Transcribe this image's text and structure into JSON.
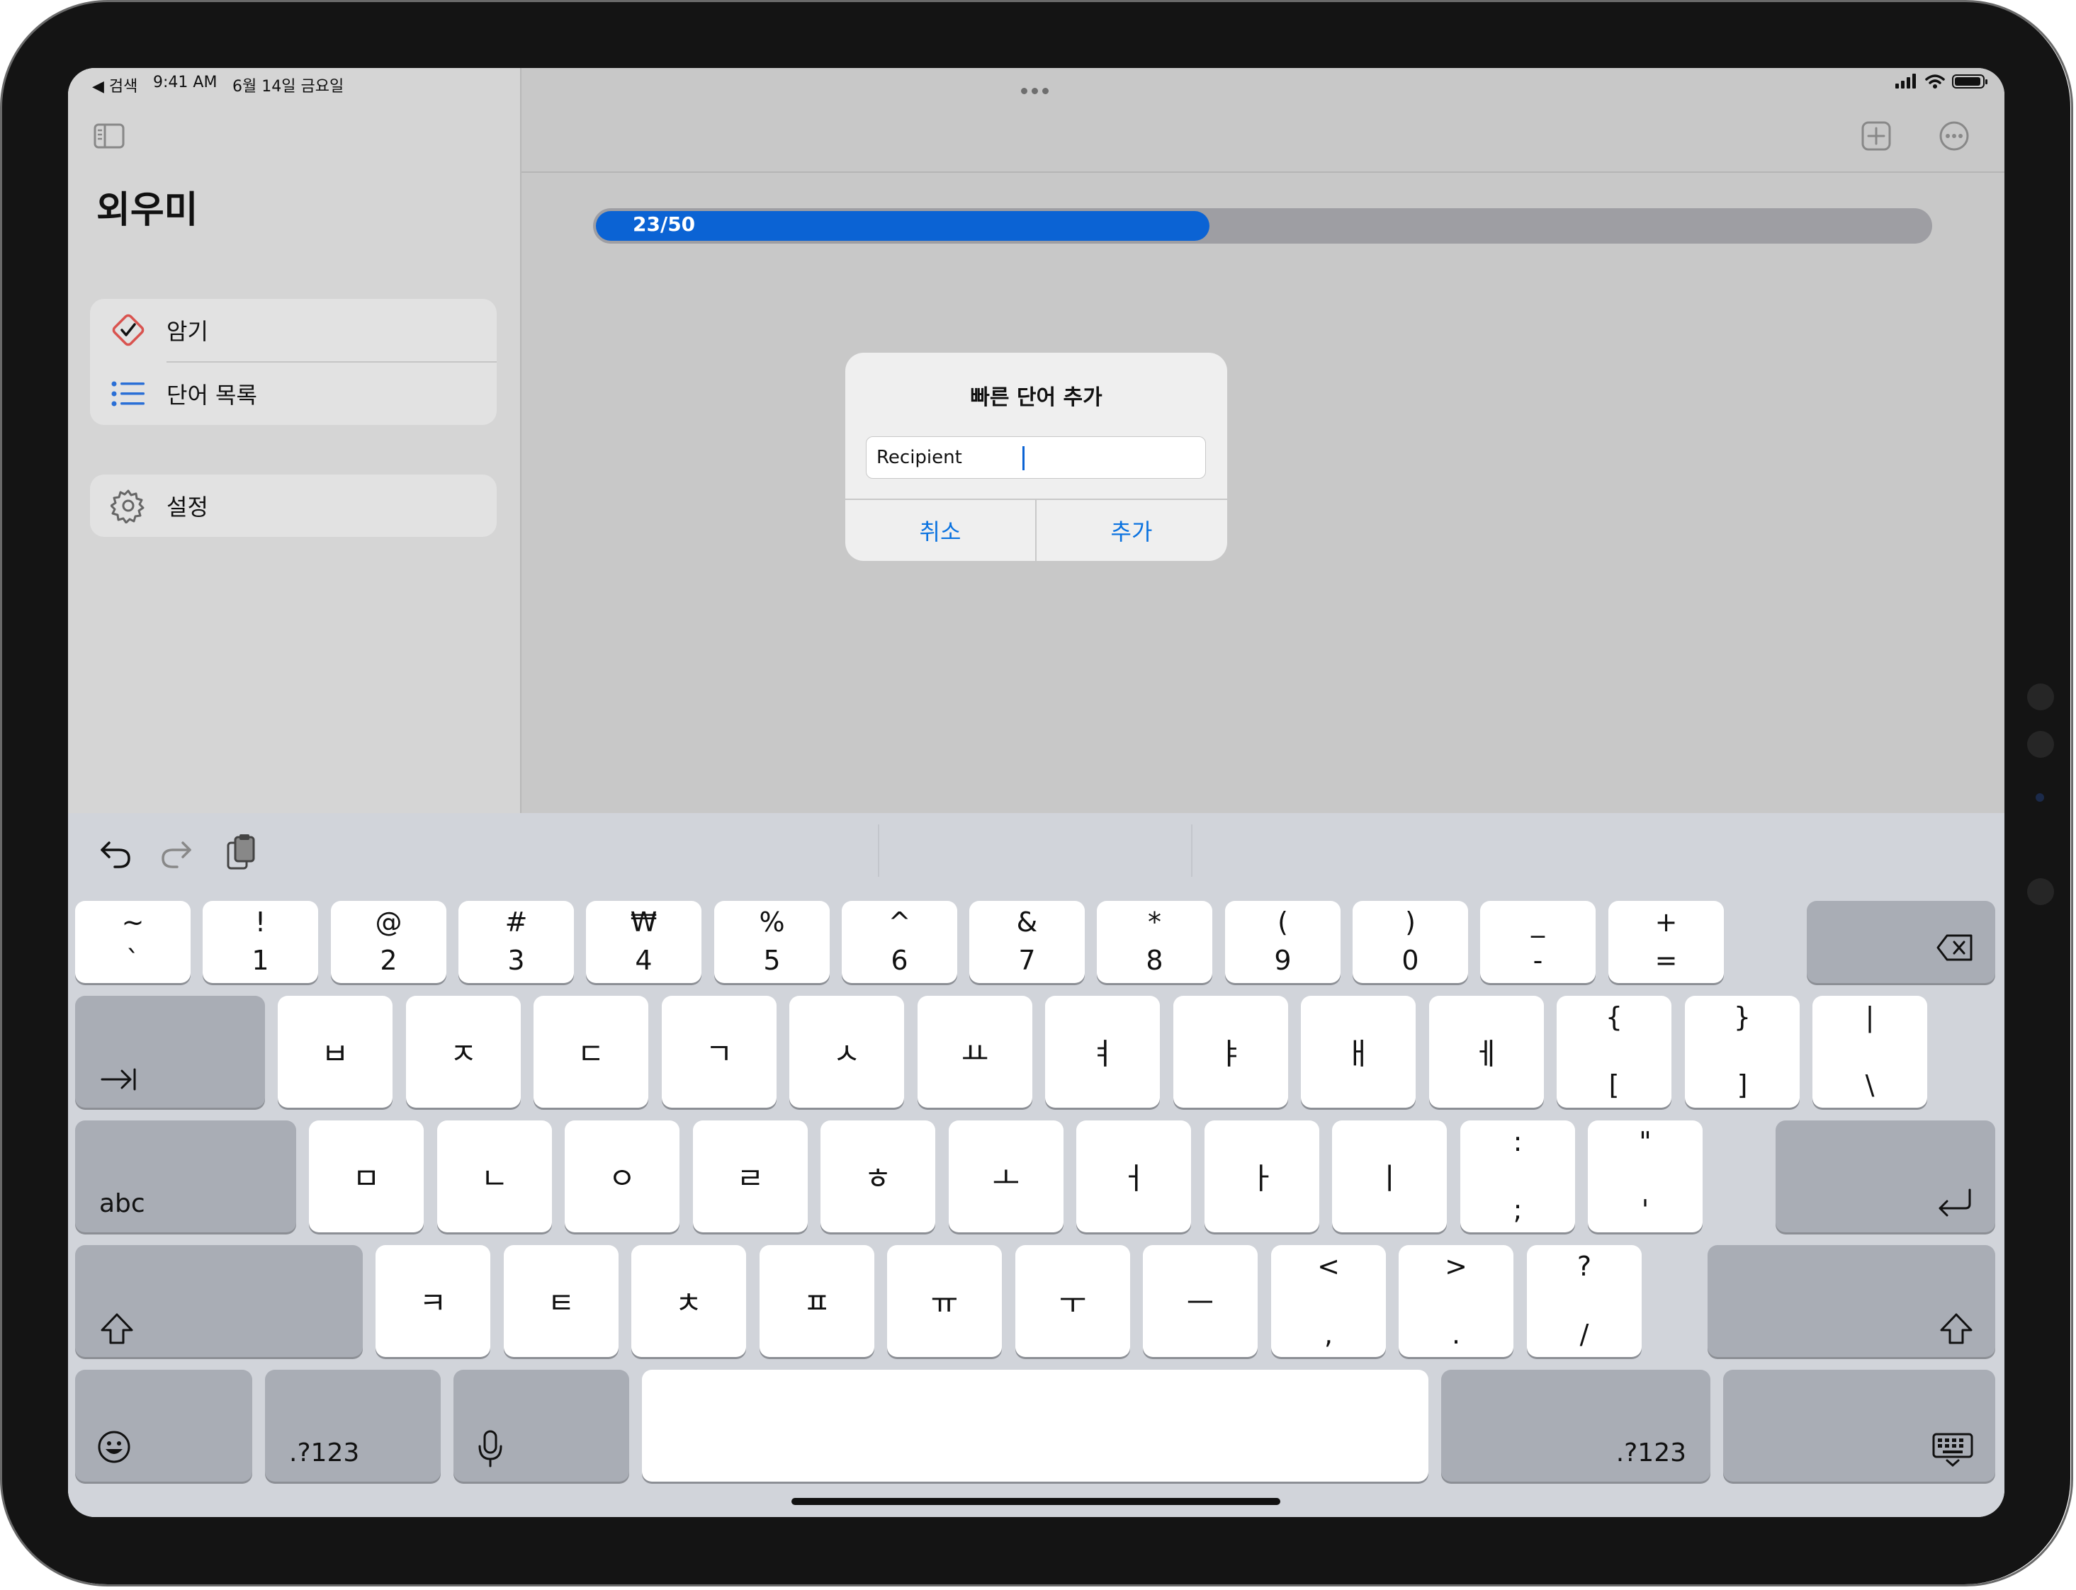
{
  "status_bar": {
    "back_label": "◀ 검색",
    "time": "9:41 AM",
    "date": "6월 14일 금요일"
  },
  "sidebar": {
    "app_title": "외우미",
    "items": [
      {
        "label": "암기",
        "icon": "checkmark-diamond-icon"
      },
      {
        "label": "단어 목록",
        "icon": "list-icon"
      },
      {
        "label": "설정",
        "icon": "gear-icon"
      }
    ]
  },
  "toolbar": {
    "icons": [
      "sidebar-toggle-icon",
      "add-square-icon",
      "more-circle-icon"
    ]
  },
  "progress": {
    "label": "23/50",
    "current": 23,
    "total": 50
  },
  "dialog": {
    "title": "빠른 단어 추가",
    "input_value": "Recipient",
    "cancel_label": "취소",
    "add_label": "추가"
  },
  "keyboard": {
    "row1": [
      {
        "s": "~",
        "m": "`"
      },
      {
        "s": "!",
        "m": "1"
      },
      {
        "s": "@",
        "m": "2"
      },
      {
        "s": "#",
        "m": "3"
      },
      {
        "s": "₩",
        "m": "4"
      },
      {
        "s": "%",
        "m": "5"
      },
      {
        "s": "^",
        "m": "6"
      },
      {
        "s": "&",
        "m": "7"
      },
      {
        "s": "*",
        "m": "8"
      },
      {
        "s": "(",
        "m": "9"
      },
      {
        "s": ")",
        "m": "0"
      },
      {
        "s": "_",
        "m": "-"
      },
      {
        "s": "+",
        "m": "="
      }
    ],
    "row2": [
      {
        "c": "ㅂ"
      },
      {
        "c": "ㅈ"
      },
      {
        "c": "ㄷ"
      },
      {
        "c": "ㄱ"
      },
      {
        "c": "ㅅ"
      },
      {
        "c": "ㅛ"
      },
      {
        "c": "ㅕ"
      },
      {
        "c": "ㅑ"
      },
      {
        "c": "ㅐ"
      },
      {
        "c": "ㅔ"
      },
      {
        "s": "{",
        "m": "["
      },
      {
        "s": "}",
        "m": "]"
      },
      {
        "s": "|",
        "m": "\\"
      }
    ],
    "row3": [
      {
        "c": "ㅁ"
      },
      {
        "c": "ㄴ"
      },
      {
        "c": "ㅇ"
      },
      {
        "c": "ㄹ"
      },
      {
        "c": "ㅎ"
      },
      {
        "c": "ㅗ"
      },
      {
        "c": "ㅓ"
      },
      {
        "c": "ㅏ"
      },
      {
        "c": "ㅣ"
      },
      {
        "s": ":",
        "m": ";"
      },
      {
        "s": "\"",
        "m": "'"
      }
    ],
    "row4": [
      {
        "c": "ㅋ"
      },
      {
        "c": "ㅌ"
      },
      {
        "c": "ㅊ"
      },
      {
        "c": "ㅍ"
      },
      {
        "c": "ㅠ"
      },
      {
        "c": "ㅜ"
      },
      {
        "c": "ㅡ"
      },
      {
        "s": "<",
        "m": ","
      },
      {
        "s": ">",
        "m": "."
      },
      {
        "s": "?",
        "m": "/"
      }
    ],
    "abc_label": "abc",
    "numbers_label": ".?123",
    "numbers_label_right": ".?123"
  }
}
